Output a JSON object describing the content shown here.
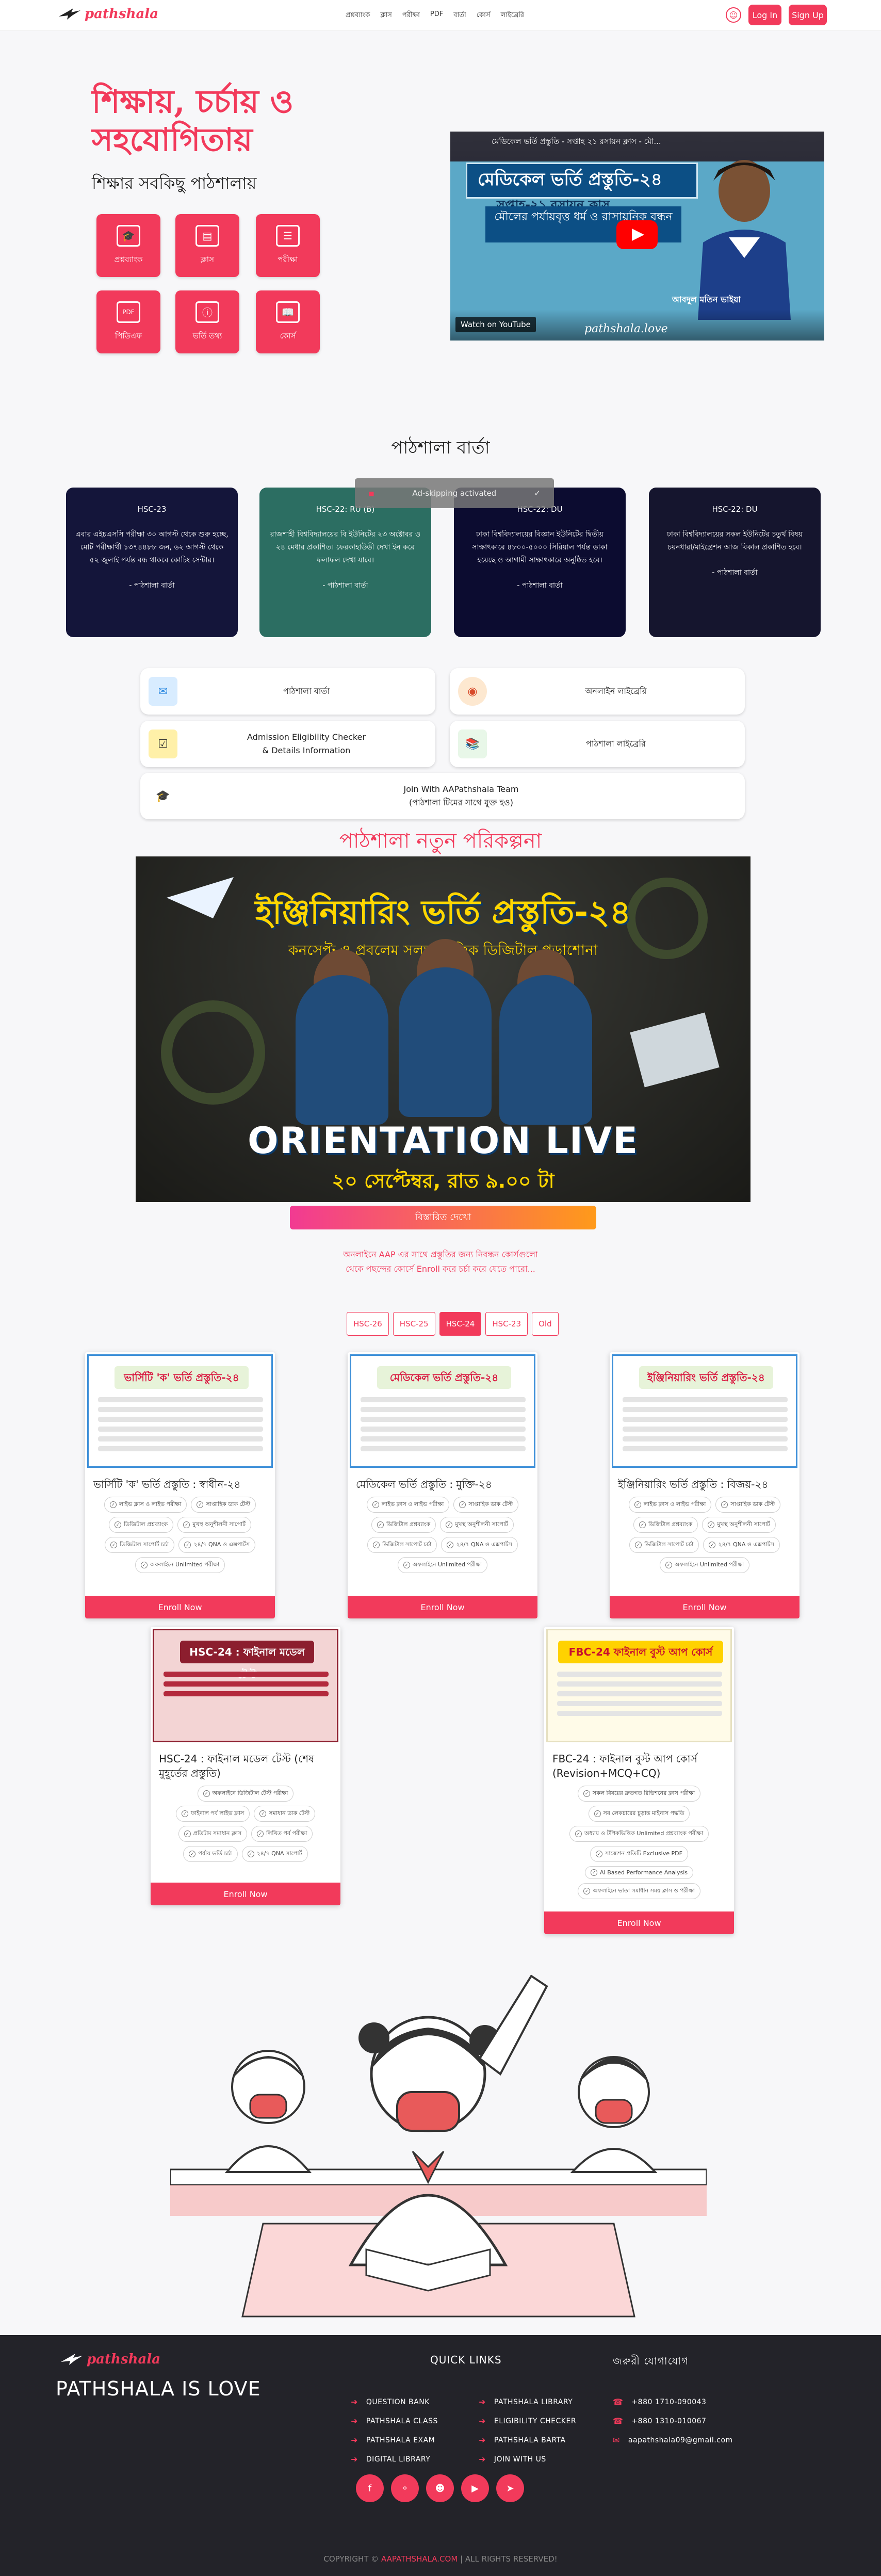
{
  "brand": {
    "logo_text": "pathshala"
  },
  "nav": {
    "links": [
      "প্রশ্নব্যাংক",
      "ক্লাস",
      "পরীক্ষা",
      "PDF",
      "বার্তা",
      "কোর্স",
      "লাইব্রেরি"
    ],
    "login": "Log In",
    "signup": "Sign Up"
  },
  "hero": {
    "title": "শিক্ষায়, চর্চায় ও সহযোগিতায়",
    "subtitle": "শিক্ষার সবকিছু পাঠশালায়",
    "tiles": [
      "প্রশ্নব্যাংক",
      "ক্লাস",
      "পরীক্ষা",
      "পিডিএফ",
      "ভর্তি তথ্য",
      "কোর্স"
    ]
  },
  "video": {
    "caption": "মেডিকেল ভর্তি প্রস্তুতি - সপ্তাহ ২১ রসায়ন ক্লাস - মৌ...",
    "title": "মেডিকেল ভর্তি প্রস্তুতি-২৪",
    "sub": "সপ্তাহ-২১ রসায়ন ক্লাস",
    "topic": "মৌলের পর্যায়বৃত্ত ধর্ম ও রাসায়নিক বন্ধন",
    "watch": "Watch on YouTube",
    "brand": "pathshala.love",
    "presenter": "আবদুল মতিন ভাইয়া"
  },
  "barta": {
    "title": "পাঠশালা বার্তা",
    "toast": "Ad-skipping activated",
    "cards": [
      {
        "tag": "HSC-23",
        "body": "এবার এইচএসসি পরীক্ষা ৩০ আগস্ট থেকে শুরু হচ্ছে, মোট পরীক্ষার্থী ১৩৭৪৪৮৮ জন, ৬২ আগস্ট থেকে ৫২ জুলাই পর্যন্ত বন্ধ থাকবে কোচিং সেন্টার।",
        "foot": "- পাঠশালা বার্তা",
        "color": "#14153a"
      },
      {
        "tag": "HSC-22: RU (B)",
        "body": "রাজশাহী বিশ্ববিদ্যালয়ের বি ইউনিটের ২৩ অক্টোবর ও ২৪ মেধার প্রকাশিত। ফেরকাহাউডী দেখা ইন করে ফলাফল দেখা যাবে।",
        "foot": "- পাঠশালা বার্তা",
        "color": "#2c6e62"
      },
      {
        "tag": "HSC-22: DU",
        "body": "ঢাকা বিশ্ববিদ্যালয়ের বিজ্ঞান ইউনিটের দ্বিতীয় সাক্ষাৎকারে ৪৮০০-৫০০০ সিরিয়াল পর্যন্ত ডাকা হয়েছে ও আগামী সাক্ষাৎকারে অনুষ্ঠিত হবে।",
        "foot": "- পাঠশালা বার্তা",
        "color": "#0c0c30"
      },
      {
        "tag": "HSC-22: DU",
        "body": "ঢাকা বিশ্ববিদ্যালয়ের সকল ইউনিটের চতুর্থ বিষয় চয়নধারা/মাইগ্রেশন আজ বিকাল প্রকাশিত হবে।",
        "foot": "- পাঠশালা বার্তা",
        "color": "#15152e"
      }
    ]
  },
  "links": [
    {
      "label": "পাঠশালা বার্তা",
      "icon": "mail-icon"
    },
    {
      "label": "অনলাইন লাইব্রেরি",
      "icon": "globe-icon"
    },
    {
      "label": "Admission Eligibility Checker\n& Details Information",
      "icon": "checker-icon"
    },
    {
      "label": "পাঠশালা লাইব্রেরি",
      "icon": "library-icon"
    },
    {
      "label": "Join With AAPathshala Team\n(পাঠশালা টিমের সাথে যুক্ত হও)",
      "icon": "team-icon"
    }
  ],
  "plan": {
    "title": "পাঠশালা নতুন পরিকল্পনা",
    "banner_title": "ইঞ্জিনিয়ারিং ভর্তি প্রস্তুতি-২৪",
    "banner_sub": "কনসেপ্ট ও প্রবলেম সলভ ভিত্তিক ডিজিটাল পড়াশোনা",
    "banner_live": "ORIENTATION LIVE",
    "banner_time": "২০ সেপ্টেম্বর, রাত ৯.০০ টা",
    "details_btn": "বিস্তারিত দেখো",
    "note": "অনলাইনে AAP এর সাথে প্রস্তুতির জন্য নিবন্ধন কোর্সগুলো\nথেকে পছন্দের কোর্সে Enroll করে চর্চা করে যেতে পারো..."
  },
  "tabs": [
    "HSC-26",
    "HSC-25",
    "HSC-24",
    "HSC-23",
    "Old"
  ],
  "courses": [
    {
      "thumb": "ভার্সিটি 'ক' ভর্তি প্রস্তুতি-২৪",
      "title": "ভার্সিটি 'ক' ভর্তি প্রস্তুতি : স্বাধীন-২৪",
      "pills": [
        "লাইভ ক্লাস ও লাইভ পরীক্ষা",
        "সাপ্তাহিক ডাক টেস্ট",
        "ডিজিটাল প্রশ্নব্যাংক",
        "মুখস্থ অনুশীলনী সাপোর্ট",
        "ডিজিটাল সাপোর্ট চর্চা",
        "২৪/৭ QNA ও এক্সপার্টস",
        "অফলাইনে Unlimited পরীক্ষা"
      ],
      "enroll": "Enroll Now"
    },
    {
      "thumb": "মেডিকেল ভর্তি প্রস্তুতি-২৪",
      "title": "মেডিকেল ভর্তি প্রস্তুতি : মুক্তি-২৪",
      "pills": [
        "লাইভ ক্লাস ও লাইভ পরীক্ষা",
        "সাপ্তাহিক ডাক টেস্ট",
        "ডিজিটাল প্রশ্নব্যাংক",
        "মুখস্থ অনুশীলনী সাপোর্ট",
        "ডিজিটাল সাপোর্ট চর্চা",
        "২৪/৭ QNA ও এক্সপার্টস",
        "অফলাইনে Unlimited পরীক্ষা"
      ],
      "enroll": "Enroll Now"
    },
    {
      "thumb": "ইঞ্জিনিয়ারিং ভর্তি প্রস্তুতি-২৪",
      "title": "ইঞ্জিনিয়ারিং ভর্তি প্রস্তুতি : বিজয়-২৪",
      "pills": [
        "লাইভ ক্লাস ও লাইভ পরীক্ষা",
        "সাপ্তাহিক ডাক টেস্ট",
        "ডিজিটাল প্রশ্নব্যাংক",
        "মুখস্থ অনুশীলনী সাপোর্ট",
        "ডিজিটাল সাপোর্ট চর্চা",
        "২৪/৭ QNA ও এক্সপার্টস",
        "অফলাইনে Unlimited পরীক্ষা"
      ],
      "enroll": "Enroll Now"
    },
    {
      "thumb": "HSC-24 : ফাইনাল মডেল টেস্ট",
      "title": "HSC-24 : ফাইনাল মডেল টেস্ট (শেষ মুহূর্তের প্রস্তুতি)",
      "pills": [
        "অফলাইনে ডিজিটাল টেস্ট পরীক্ষা",
        "ফাইনাল পর্ব লাইভ ক্লাস",
        "সমাধান ডাক টেস্ট",
        "প্রতিটাম সমাধান ক্লাস",
        "লিখিত পর্ব পরীক্ষা",
        "পর্যায় ভর্তি চর্চা",
        "২৪/৭ QNA সাপোর্ট"
      ],
      "enroll": "Enroll Now"
    },
    {
      "thumb": "FBC-24 ফাইনাল বুস্ট আপ কোর্স",
      "title": "FBC-24 : ফাইনাল বুস্ট আপ কোর্স (Revision+MCQ+CQ)",
      "pills": [
        "সকল বিষয়ের দ্রুতগত রিভিশনের ক্লাস পরীক্ষা",
        "সব লেকচারের চূড়ান্ত মাইনাস পদ্ধতি",
        "অধ্যায় ও টপিকভিত্তিক Unlimited প্রশ্নব্যাংক পরীক্ষা",
        "সাজেশন প্রতিটি Exclusive PDF",
        "AI Based Performance Analysis",
        "অফলাইনে ভাতা সমাধান সময় ক্লাস ও পরীক্ষা"
      ],
      "enroll": "Enroll Now"
    }
  ],
  "footer": {
    "brand": "PATHSHALA IS LOVE",
    "quick_title": "QUICK LINKS",
    "contact_title": "জরুরী যোগাযোগ",
    "links_col1": [
      "QUESTION BANK",
      "PATHSHALA CLASS",
      "PATHSHALA EXAM",
      "DIGITAL LIBRARY"
    ],
    "links_col2": [
      "PATHSHALA LIBRARY",
      "ELIGIBILITY CHECKER",
      "PATHSHALA BARTA",
      "JOIN WITH US"
    ],
    "contacts": [
      "+880 1710-090043",
      "+880 1310-010067",
      "aapathshala09@gmail.com"
    ],
    "social": [
      "facebook-icon",
      "messenger-icon",
      "group-icon",
      "youtube-icon",
      "telegram-icon"
    ],
    "copyright_prefix": "COPYRIGHT ©",
    "copyright_site": "AAPATHSHALA.COM",
    "copyright_suffix": "| ALL RIGHTS RESERVED!"
  },
  "colors": {
    "accent": "#f23a5b",
    "footer_bg": "#232329"
  }
}
